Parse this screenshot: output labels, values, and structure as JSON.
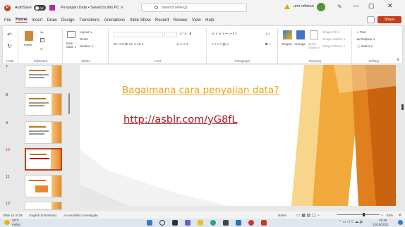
{
  "titlebar": {
    "autosave_label": "AutoSave",
    "autosave_state": "Off",
    "doc_title": "Penyajian Data • Saved to this PC ∨",
    "search_placeholder": "Search (Alt+Q)",
    "user_name": "umi rofiatun",
    "user_initials": "UR",
    "minimize": "—",
    "restore": "▢",
    "close": "✕"
  },
  "menu": {
    "items": [
      "File",
      "Home",
      "Insert",
      "Draw",
      "Design",
      "Transitions",
      "Animations",
      "Slide Show",
      "Record",
      "Review",
      "View",
      "Help"
    ],
    "share_label": "Share"
  },
  "ribbon": {
    "groups": {
      "undo": "Undo",
      "clipboard": "Clipboard",
      "slides": "Slides",
      "font": "Font",
      "paragraph": "Paragraph",
      "drawing": "Drawing",
      "editing": "Editing"
    },
    "paste": "Paste",
    "new_slide": "New Slide ∨",
    "layout": "Layout ∨",
    "reset": "Reset",
    "section": "Section ∨",
    "font_btns": "B  I  U  S  ab  AV ∨  Aa ∨",
    "shapes": "Shapes",
    "arrange": "Arrange",
    "quick_styles": "Quick Styles ∨",
    "shape_fill": "Shape Fill ∨",
    "shape_outline": "Shape Outline ∨",
    "shape_effects": "Shape Effects ∨",
    "find": "Find",
    "replace": "Replace ∨",
    "select": "Select ∨"
  },
  "thumbnails": [
    {
      "num": "7"
    },
    {
      "num": "8"
    },
    {
      "num": "9"
    },
    {
      "num": "10"
    },
    {
      "num": "11"
    },
    {
      "num": "12"
    }
  ],
  "slide": {
    "title": "Bagaimana cara penyajian data?",
    "link": "http://asblr.com/yG8fL"
  },
  "status": {
    "slide_count": "Slide 10 of 29",
    "language": "English (Indonesia)",
    "accessibility": "Accessibility: Investigate",
    "notes": "Notes",
    "zoom": "63%"
  },
  "taskbar": {
    "weather_temp": "28°C",
    "weather_desc": "Kabut",
    "time": "22:45",
    "date": "12/10/2022"
  },
  "colors": {
    "accent": "#c43e1c",
    "slide_title": "#e8a317",
    "slide_link": "#b5121b"
  }
}
